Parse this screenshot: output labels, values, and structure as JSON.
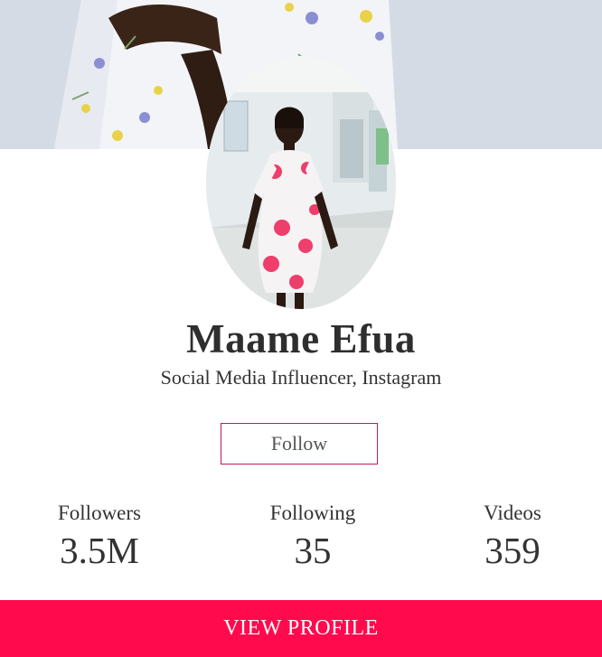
{
  "profile": {
    "name": "Maame Efua",
    "title": "Social Media Influencer, Instagram"
  },
  "actions": {
    "follow_label": "Follow",
    "view_profile_label": "VIEW PROFILE"
  },
  "stats": {
    "followers": {
      "label": "Followers",
      "value": "3.5M"
    },
    "following": {
      "label": "Following",
      "value": "35"
    },
    "videos": {
      "label": "Videos",
      "value": "359"
    }
  },
  "colors": {
    "accent": "#ff0a4d",
    "follow_border": "#c2185b",
    "text": "#333333"
  }
}
